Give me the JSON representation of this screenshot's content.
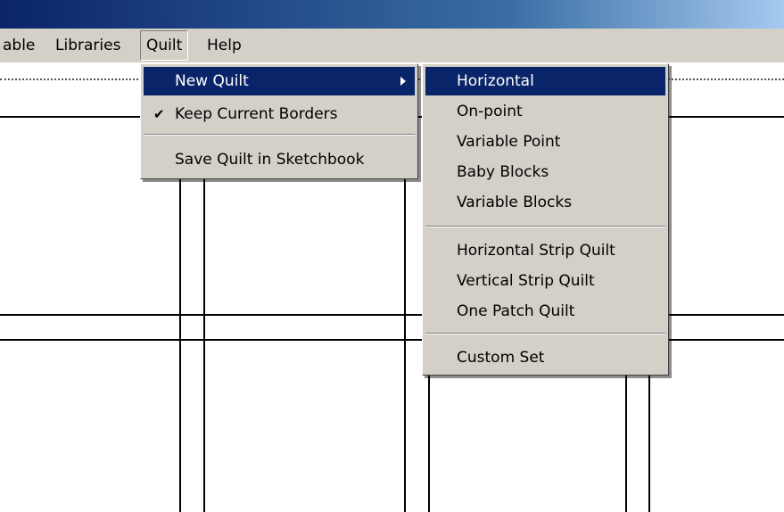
{
  "menubar": {
    "items": [
      {
        "label": "able"
      },
      {
        "label": "Libraries"
      },
      {
        "label": "Quilt"
      },
      {
        "label": "Help"
      }
    ]
  },
  "quilt_menu": {
    "new_quilt": "New Quilt",
    "keep_current_borders": "Keep Current Borders",
    "keep_current_borders_checked": true,
    "save_quilt": "Save Quilt in Sketchbook"
  },
  "new_quilt_submenu": {
    "items": [
      "Horizontal",
      "On-point",
      "Variable Point",
      "Baby Blocks",
      "Variable Blocks",
      "Horizontal Strip Quilt",
      "Vertical Strip Quilt",
      "One Patch Quilt",
      "Custom Set"
    ],
    "selected": "Horizontal"
  },
  "colors": {
    "highlight": "#0a246a",
    "menu_bg": "#d4d0c8"
  }
}
